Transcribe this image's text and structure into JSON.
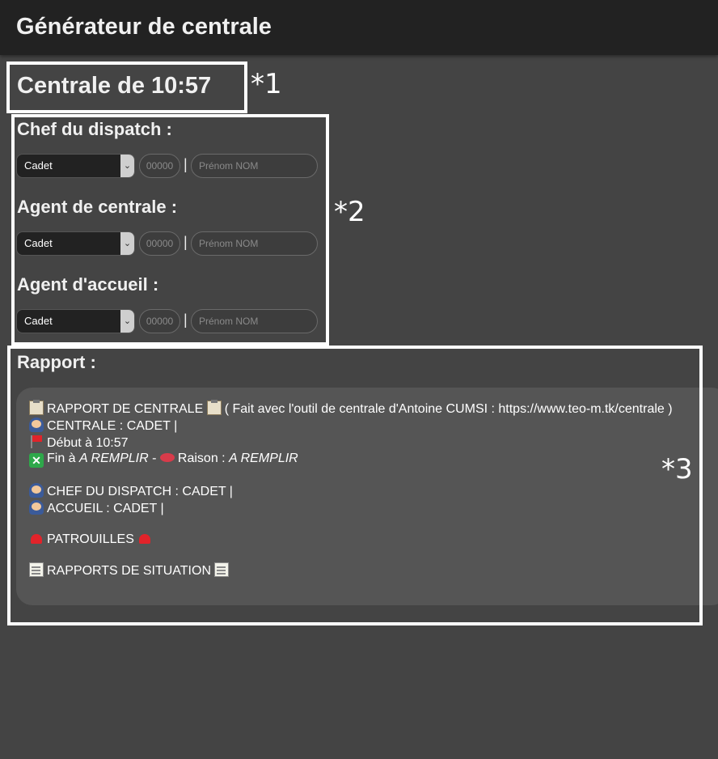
{
  "app": {
    "title": "Générateur de centrale"
  },
  "centrale": {
    "title": "Centrale de 10:57"
  },
  "annotations": {
    "a1": "*1",
    "a2": "*2",
    "a3": "*3"
  },
  "roles": [
    {
      "label": "Chef du dispatch :",
      "grade": "Cadet",
      "number_placeholder": "00000",
      "separator": "|",
      "name_placeholder": "Prénom NOM"
    },
    {
      "label": "Agent de centrale :",
      "grade": "Cadet",
      "number_placeholder": "00000",
      "separator": "|",
      "name_placeholder": "Prénom NOM"
    },
    {
      "label": "Agent d'accueil :",
      "grade": "Cadet",
      "number_placeholder": "00000",
      "separator": "|",
      "name_placeholder": "Prénom NOM"
    }
  ],
  "rapport": {
    "title": "Rapport :",
    "line1": "RAPPORT DE CENTRALE",
    "line1_suffix": "( Fait avec l'outil de centrale d'Antoine CUMSI : https://www.teo-m.tk/centrale )",
    "line2": "CENTRALE : CADET |",
    "line3": "Début à 10:57",
    "line4_prefix": "Fin à",
    "line4_fin": "A REMPLIR",
    "line4_sep": "-",
    "line4_raison_label": "Raison :",
    "line4_raison": "A REMPLIR",
    "line5": "CHEF DU DISPATCH : CADET |",
    "line6": "ACCUEIL : CADET |",
    "line7": "PATROUILLES",
    "line8": "RAPPORTS DE SITUATION"
  },
  "icons": {
    "clipboard": "clipboard-icon",
    "police": "police-officer-icon",
    "flag": "triangular-flag-icon",
    "cross": "cross-mark-icon",
    "lips": "lips-icon",
    "siren": "police-light-icon",
    "memo": "memo-icon"
  },
  "colors": {
    "background": "#444444",
    "topbar": "#222222",
    "panel": "#555555"
  }
}
